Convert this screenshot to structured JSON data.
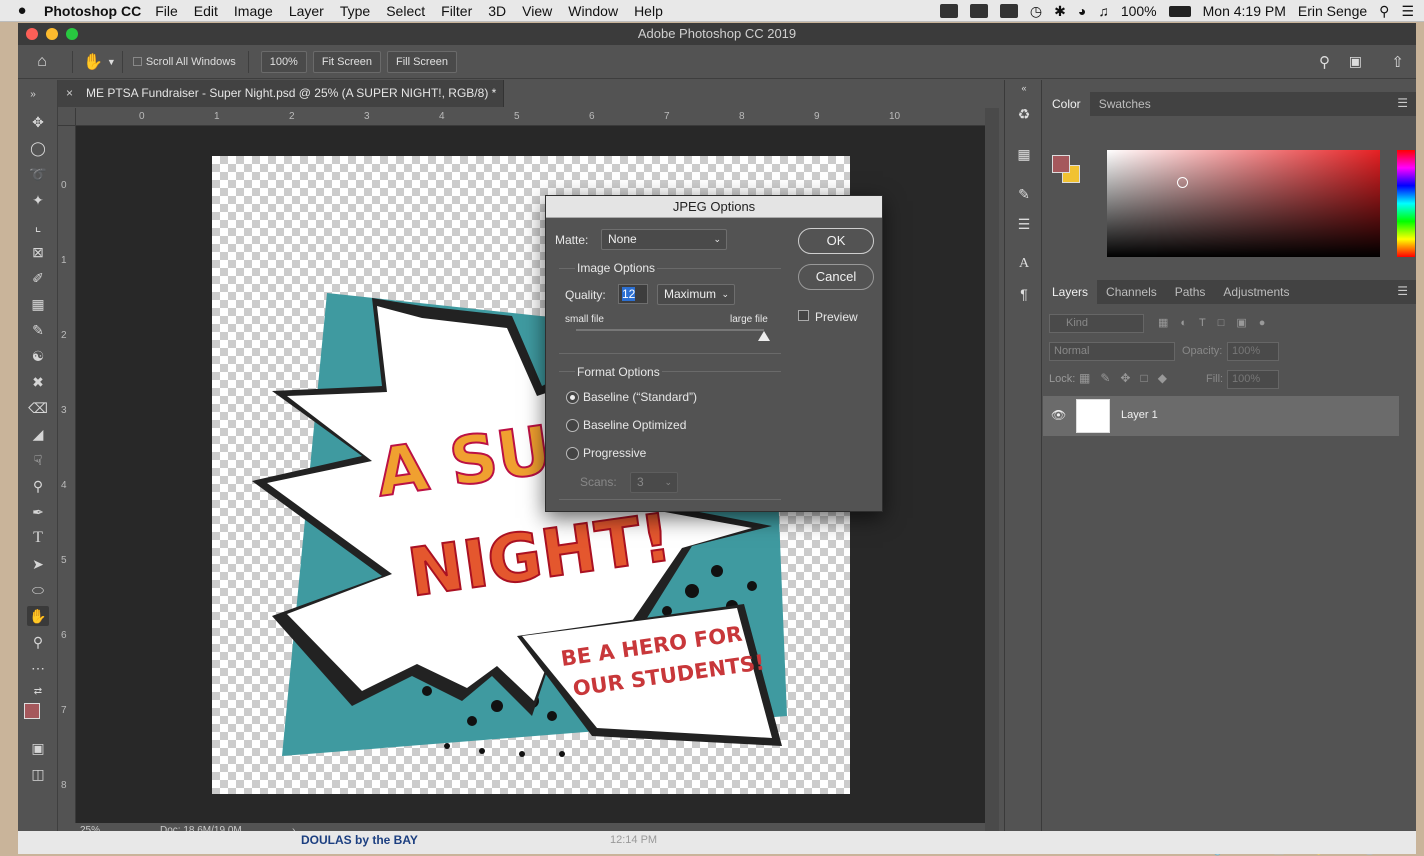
{
  "menubar": {
    "apple": "",
    "app": "Photoshop CC",
    "items": [
      "File",
      "Edit",
      "Image",
      "Layer",
      "Type",
      "Select",
      "Filter",
      "3D",
      "View",
      "Window",
      "Help"
    ],
    "battery": "100%",
    "clock": "Mon 4:19 PM",
    "user": "Erin Senge"
  },
  "window": {
    "title": "Adobe Photoshop CC 2019"
  },
  "options": {
    "scroll_all": "Scroll All Windows",
    "zoom": "100%",
    "fit": "Fit Screen",
    "fill": "Fill Screen"
  },
  "document": {
    "tab": "ME PTSA Fundraiser - Super Night.psd @ 25% (A SUPER  NIGHT!, RGB/8) *",
    "line1": "A SUP",
    "line2": "NIGHT!",
    "banner1": "BE A HERO FOR",
    "banner2": "OUR STUDENTS!",
    "zoom": "25%",
    "docsize": "Doc: 18.6M/19.0M"
  },
  "ruler_h": [
    "1",
    "0",
    "1",
    "2",
    "3",
    "4",
    "5",
    "6",
    "7",
    "8",
    "9",
    "10"
  ],
  "ruler_v": [
    "0",
    "1",
    "2",
    "3",
    "4",
    "5",
    "6",
    "7",
    "8"
  ],
  "dialog": {
    "title": "JPEG Options",
    "matte_label": "Matte:",
    "matte_value": "None",
    "ok": "OK",
    "cancel": "Cancel",
    "preview": "Preview",
    "image_options": "Image Options",
    "quality_label": "Quality:",
    "quality_value": "12",
    "quality_preset": "Maximum",
    "small_file": "small file",
    "large_file": "large file",
    "quality_level": 1.0,
    "format_options": "Format Options",
    "baseline": "Baseline (“Standard”)",
    "baseline_opt": "Baseline Optimized",
    "progressive": "Progressive",
    "scans_label": "Scans:",
    "scans_value": "3"
  },
  "color_panel": {
    "tab1": "Color",
    "tab2": "Swatches",
    "fg": "#a5585c",
    "bg": "#f1c232"
  },
  "layers_panel": {
    "tabs": [
      "Layers",
      "Channels",
      "Paths",
      "Adjustments"
    ],
    "kind": "Kind",
    "blend": "Normal",
    "opacity_label": "Opacity:",
    "opacity": "100%",
    "lock_label": "Lock:",
    "fill_label": "Fill:",
    "fill": "100%",
    "layer_name": "Layer 1"
  },
  "dock": {
    "note_title": "DOULAS by the BAY",
    "note_time": "12:14 PM"
  }
}
